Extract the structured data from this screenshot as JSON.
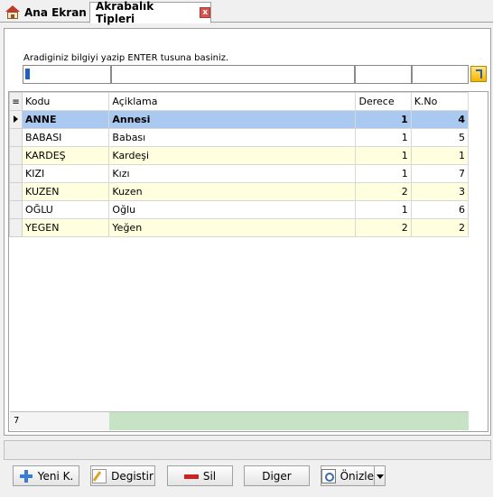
{
  "tabs": [
    {
      "label": "Ana Ekran",
      "icon": "home-icon"
    },
    {
      "label": "Akrabalık Tipleri",
      "icon": "close-icon"
    }
  ],
  "search": {
    "label": "Aradiginiz bilgiyi yazip ENTER tusuna basiniz.",
    "value": ""
  },
  "grid": {
    "columns": [
      "Kodu",
      "Açiklama",
      "Derece",
      "K.No"
    ],
    "rows": [
      {
        "code": "ANNE",
        "desc": "Annesi",
        "derece": "1",
        "kno": "4"
      },
      {
        "code": "BABASI",
        "desc": "Babası",
        "derece": "1",
        "kno": "5"
      },
      {
        "code": "KARDEŞ",
        "desc": "Kardeşi",
        "derece": "1",
        "kno": "1"
      },
      {
        "code": "KIZI",
        "desc": "Kızı",
        "derece": "1",
        "kno": "7"
      },
      {
        "code": "KUZEN",
        "desc": "Kuzen",
        "derece": "2",
        "kno": "3"
      },
      {
        "code": "OĞLU",
        "desc": "Oğlu",
        "derece": "1",
        "kno": "6"
      },
      {
        "code": "YEGEN",
        "desc": "Yeğen",
        "derece": "2",
        "kno": "2"
      }
    ],
    "footer_count": "7"
  },
  "buttons": {
    "new": "Yeni K.",
    "edit": "Degistir",
    "delete": "Sil",
    "other": "Diger",
    "preview": "Önizle"
  },
  "colors": {
    "selected_row": "#a9c9f0",
    "odd_row": "#ffffdf",
    "footer_fill": "#c6e3c6"
  }
}
